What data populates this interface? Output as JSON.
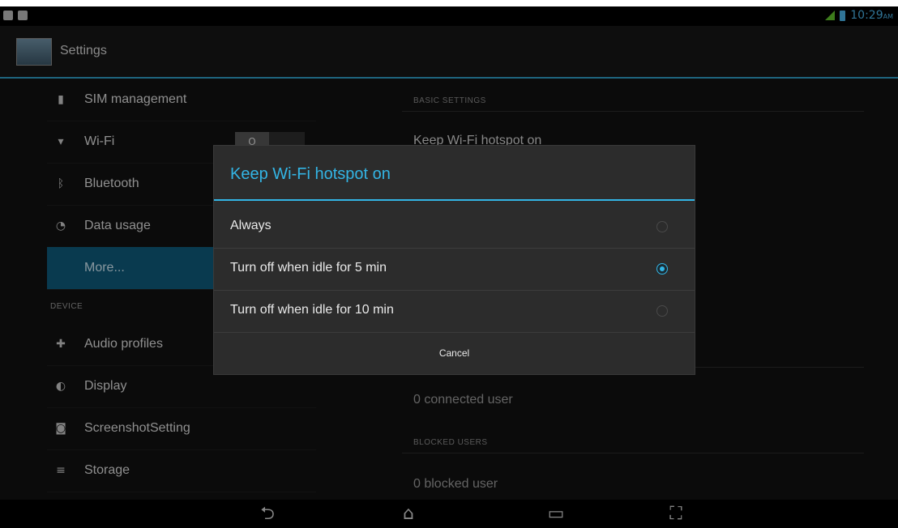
{
  "status_bar": {
    "time": "10:29",
    "ampm": "AM",
    "left_icons": [
      "notification-icon",
      "screen-icon"
    ],
    "right_icons": [
      "signal-icon",
      "battery-icon"
    ]
  },
  "action_bar": {
    "title": "Settings"
  },
  "left_pane": {
    "items": [
      {
        "label": "SIM management",
        "icon": "sim-icon"
      },
      {
        "label": "Wi-Fi",
        "icon": "wifi-icon"
      },
      {
        "label": "Bluetooth",
        "icon": "bluetooth-icon"
      },
      {
        "label": "Data usage",
        "icon": "data-usage-icon"
      },
      {
        "label": "More...",
        "selected": true
      }
    ],
    "device_header": "DEVICE",
    "device_items": [
      {
        "label": "Audio profiles",
        "icon": "audio-icon"
      },
      {
        "label": "Display",
        "icon": "display-icon"
      },
      {
        "label": "ScreenshotSetting",
        "icon": "camera-icon"
      },
      {
        "label": "Storage",
        "icon": "storage-icon"
      }
    ],
    "wifi_toggle_state": "O"
  },
  "right_pane": {
    "basic_header": "BASIC SETTINGS",
    "keep_hotspot": "Keep Wi-Fi hotspot on",
    "connected": "0 connected user",
    "blocked_header": "BLOCKED USERS",
    "blocked": "0 blocked user"
  },
  "dialog": {
    "title": "Keep Wi-Fi hotspot on",
    "options": [
      {
        "label": "Always",
        "selected": false
      },
      {
        "label": "Turn off when idle for 5 min",
        "selected": true
      },
      {
        "label": "Turn off when idle for 10 min",
        "selected": false
      }
    ],
    "cancel_label": "Cancel"
  },
  "nav_bar": {
    "buttons": [
      "back-icon",
      "home-icon",
      "recent-apps-icon",
      "screenshot-icon"
    ]
  },
  "colors": {
    "accent": "#33b5e5",
    "selected_row": "#0f5a7a",
    "dialog_bg": "#2c2c2c"
  }
}
